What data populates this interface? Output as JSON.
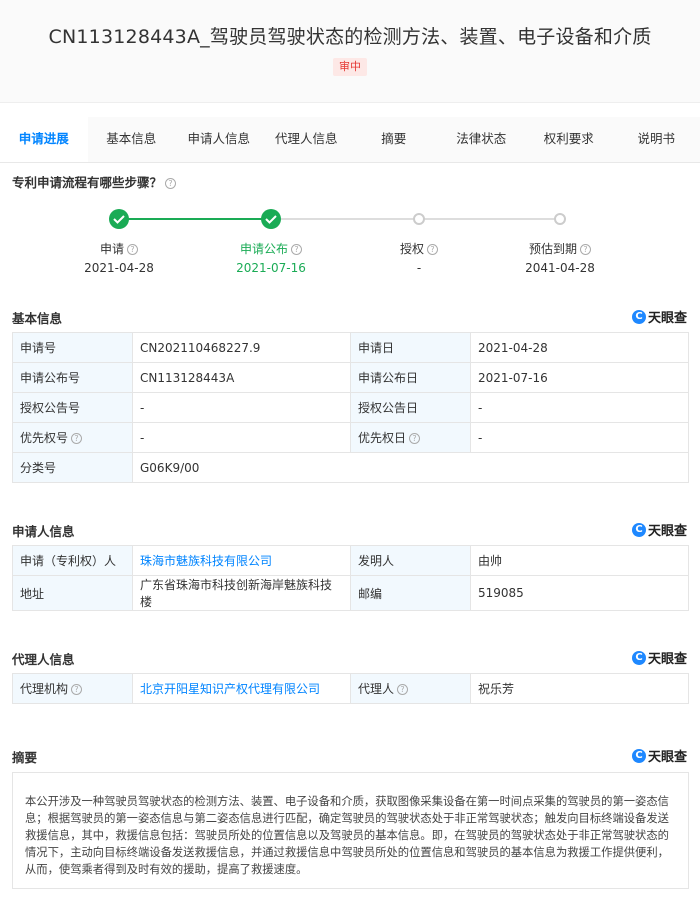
{
  "header": {
    "title": "CN113128443A_驾驶员驾驶状态的检测方法、装置、电子设备和介质",
    "status_badge": "审中"
  },
  "tabs": [
    {
      "label": "申请进展"
    },
    {
      "label": "基本信息"
    },
    {
      "label": "申请人信息"
    },
    {
      "label": "代理人信息"
    },
    {
      "label": "摘要"
    },
    {
      "label": "法律状态"
    },
    {
      "label": "权利要求"
    },
    {
      "label": "说明书"
    }
  ],
  "process": {
    "title": "专利申请流程有哪些步骤？",
    "steps": [
      {
        "name": "申请",
        "date": "2021-04-28",
        "done": true
      },
      {
        "name": "申请公布",
        "date": "2021-07-16",
        "done": true
      },
      {
        "name": "授权",
        "date": "-",
        "done": false
      },
      {
        "name": "预估到期",
        "date": "2041-04-28",
        "done": false
      }
    ]
  },
  "logo_text": "天眼查",
  "basic": {
    "title": "基本信息",
    "rows": [
      {
        "l1": "申请号",
        "v1": "CN202110468227.9",
        "l2": "申请日",
        "v2": "2021-04-28"
      },
      {
        "l1": "申请公布号",
        "v1": "CN113128443A",
        "l2": "申请公布日",
        "v2": "2021-07-16"
      },
      {
        "l1": "授权公告号",
        "v1": "-",
        "l2": "授权公告日",
        "v2": "-"
      },
      {
        "l1": "优先权号",
        "v1": "-",
        "l2": "优先权日",
        "v2": "-"
      },
      {
        "l1": "分类号",
        "v1": "G06K9/00"
      }
    ]
  },
  "applicant": {
    "title": "申请人信息",
    "rows": [
      {
        "l1": "申请（专利权）人",
        "v1": "珠海市魅族科技有限公司",
        "l2": "发明人",
        "v2": "由帅"
      },
      {
        "l1": "地址",
        "v1": "广东省珠海市科技创新海岸魅族科技楼",
        "l2": "邮编",
        "v2": "519085"
      }
    ]
  },
  "agent": {
    "title": "代理人信息",
    "rows": [
      {
        "l1": "代理机构",
        "v1": "北京开阳星知识产权代理有限公司",
        "l2": "代理人",
        "v2": "祝乐芳"
      }
    ]
  },
  "abstract": {
    "title": "摘要",
    "text": "本公开涉及一种驾驶员驾驶状态的检测方法、装置、电子设备和介质，获取图像采集设备在第一时间点采集的驾驶员的第一姿态信息；根据驾驶员的第一姿态信息与第二姿态信息进行匹配，确定驾驶员的驾驶状态处于非正常驾驶状态；触发向目标终端设备发送救援信息，其中，救援信息包括：驾驶员所处的位置信息以及驾驶员的基本信息。即，在驾驶员的驾驶状态处于非正常驾驶状态的情况下，主动向目标终端设备发送救援信息，并通过救援信息中驾驶员所处的位置信息和驾驶员的基本信息为救援工作提供便利，从而，使驾乘者得到及时有效的援助，提高了救援速度。"
  },
  "colors": {
    "accent": "#0084ff",
    "done_green": "#1aab55",
    "label_bg": "#f2f9fe"
  }
}
